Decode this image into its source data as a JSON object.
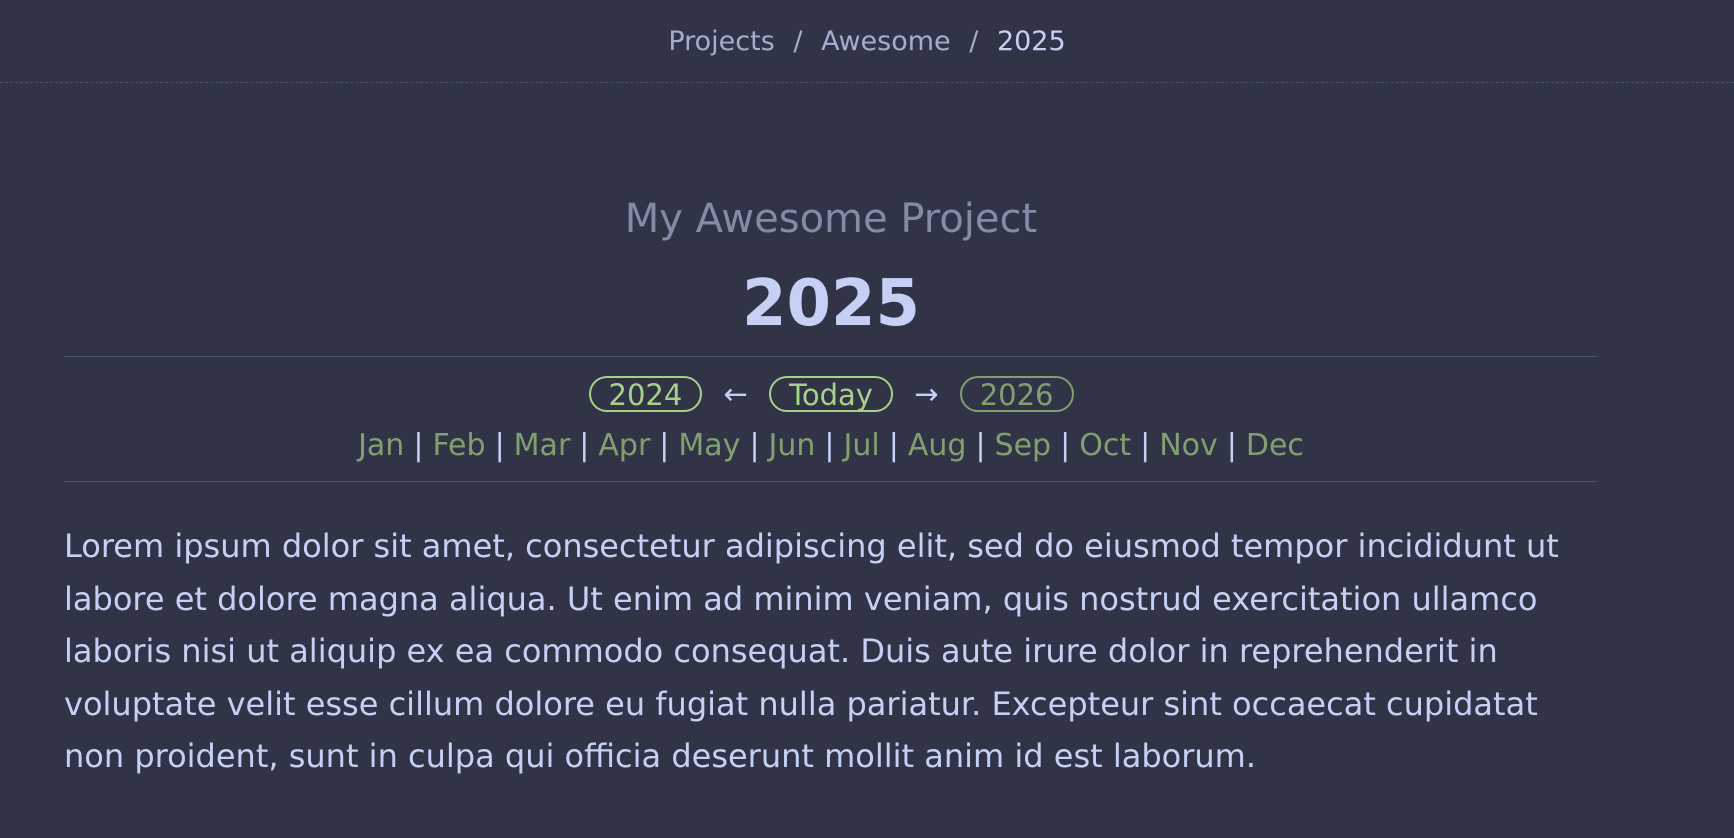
{
  "breadcrumb": {
    "items": [
      "Projects",
      "Awesome"
    ],
    "separator": "/",
    "current": "2025"
  },
  "header": {
    "project_name": "My Awesome Project",
    "year": "2025"
  },
  "year_nav": {
    "prev_label": "2024",
    "prev_arrow": "←",
    "today_label": "Today",
    "next_arrow": "→",
    "next_label": "2026"
  },
  "months": {
    "separator": "|",
    "items": [
      "Jan",
      "Feb",
      "Mar",
      "Apr",
      "May",
      "Jun",
      "Jul",
      "Aug",
      "Sep",
      "Oct",
      "Nov",
      "Dec"
    ]
  },
  "content": {
    "lines": [
      "Lorem ipsum dolor sit amet, consectetur adipiscing elit, sed do eiusmod tempor incididunt ut",
      "labore et dolore magna aliqua. Ut enim ad minim veniam, quis nostrud exercitation ullamco",
      "laboris nisi ut aliquip ex ea commodo consequat. Duis aute irure dolor in reprehenderit in",
      "voluptate velit esse cillum dolore eu fugiat nulla pariatur. Excepteur sint occaecat cupidatat",
      "non proident, sunt in culpa qui officia deserunt mollit anim id est laborum."
    ]
  },
  "colors": {
    "background": "#303446",
    "text": "#c6d0f5",
    "accent_green": "#a6d189",
    "muted_green": "#81a070",
    "muted_text": "#838ba7"
  }
}
